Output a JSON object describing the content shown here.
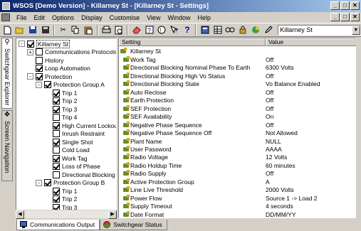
{
  "window": {
    "title": "WSOS [Demo Version] - Killarney St - [Killarney St - Settings]",
    "buttons": [
      "_",
      "□",
      "✕"
    ]
  },
  "menu": {
    "items": [
      "File",
      "Edit",
      "Options",
      "Display",
      "Customise",
      "View",
      "Window",
      "Help"
    ],
    "mdi_buttons": [
      "_",
      "□",
      "✕"
    ]
  },
  "toolbar": {
    "icons": [
      "new-icon",
      "open-icon",
      "save-icon",
      "save-all-icon",
      "cut-icon",
      "copy-icon",
      "paste-icon",
      "print-icon",
      "print-preview-icon",
      "eraser-icon",
      "help-icon",
      "whats-this-icon",
      "help-question-icon",
      "calculator-icon",
      "grid-icon",
      "link-icon",
      "lock-icon",
      "pie-icon",
      "pen-icon"
    ],
    "site_combo": "Killarney St"
  },
  "side_tabs": [
    "Switchgear Explorer",
    "Screen Navigation"
  ],
  "tree": [
    {
      "indent": 0,
      "expander": "-",
      "checked": true,
      "label": "Killarney St",
      "selected": true
    },
    {
      "indent": 1,
      "expander": "+",
      "checked": false,
      "label": "Communications Protocols"
    },
    {
      "indent": 1,
      "expander": "",
      "checked": false,
      "label": "History"
    },
    {
      "indent": 1,
      "expander": "",
      "checked": true,
      "label": "Loop Automation"
    },
    {
      "indent": 1,
      "expander": "-",
      "checked": true,
      "label": "Protection"
    },
    {
      "indent": 2,
      "expander": "-",
      "checked": true,
      "label": "Protection Group A"
    },
    {
      "indent": 3,
      "expander": "",
      "checked": true,
      "label": "Trip 1"
    },
    {
      "indent": 3,
      "expander": "",
      "checked": true,
      "label": "Trip 2"
    },
    {
      "indent": 3,
      "expander": "",
      "checked": true,
      "label": "Trip 3"
    },
    {
      "indent": 3,
      "expander": "",
      "checked": false,
      "label": "Trip 4"
    },
    {
      "indent": 3,
      "expander": "",
      "checked": true,
      "label": "High Current Lockout"
    },
    {
      "indent": 3,
      "expander": "",
      "checked": false,
      "label": "Inrush Restraint"
    },
    {
      "indent": 3,
      "expander": "",
      "checked": true,
      "label": "Single Shot"
    },
    {
      "indent": 3,
      "expander": "",
      "checked": false,
      "label": "Cold Load"
    },
    {
      "indent": 3,
      "expander": "",
      "checked": true,
      "label": "Work Tag"
    },
    {
      "indent": 3,
      "expander": "",
      "checked": true,
      "label": "Loss of Phase"
    },
    {
      "indent": 3,
      "expander": "",
      "checked": false,
      "label": "Directional Blocking"
    },
    {
      "indent": 2,
      "expander": "-",
      "checked": true,
      "label": "Protection Group B"
    },
    {
      "indent": 3,
      "expander": "",
      "checked": true,
      "label": "Trip 1"
    },
    {
      "indent": 3,
      "expander": "",
      "checked": true,
      "label": "Trip 2"
    },
    {
      "indent": 3,
      "expander": "",
      "checked": true,
      "label": "Trip 3"
    },
    {
      "indent": 3,
      "expander": "",
      "checked": true,
      "label": "Trip 4"
    }
  ],
  "props": {
    "headers": {
      "setting": "Setting",
      "value": "Value"
    },
    "root": "Killarney St",
    "rows": [
      {
        "name": "Work Tag",
        "value": "Off"
      },
      {
        "name": "Directional Blocking Nominal Phase To Earth",
        "value": "6300 Volts"
      },
      {
        "name": "Directional Blocking High Vo Status",
        "value": "Off"
      },
      {
        "name": "Directional Blocking State",
        "value": "Vo Balance Enabled"
      },
      {
        "name": "Auto Reclose",
        "value": "Off"
      },
      {
        "name": "Earth Protection",
        "value": "Off"
      },
      {
        "name": "SEF Protection",
        "value": "Off"
      },
      {
        "name": "SEF Availability",
        "value": "On"
      },
      {
        "name": "Negative Phase Sequence",
        "value": "Off"
      },
      {
        "name": "Negative Phase Sequence Off",
        "value": "Not Allowed"
      },
      {
        "name": "Plant Name",
        "value": "NULL"
      },
      {
        "name": "User Password",
        "value": "AAAA"
      },
      {
        "name": "Radio Voltage",
        "value": "12 Volts"
      },
      {
        "name": "Radio Holdup Time",
        "value": "60 minutes"
      },
      {
        "name": "Radio Supply",
        "value": "Off"
      },
      {
        "name": "Active Protection Group",
        "value": "A"
      },
      {
        "name": "Line Live Threshold",
        "value": "2000 Volts"
      },
      {
        "name": "Power Flow",
        "value": "Source 1 -> Load 2"
      },
      {
        "name": "Supply Timeout",
        "value": "4 seconds"
      },
      {
        "name": "Date Format",
        "value": "DD/MM/YY"
      }
    ]
  },
  "status_tabs": [
    "Communications Output",
    "Switchgear Status"
  ]
}
